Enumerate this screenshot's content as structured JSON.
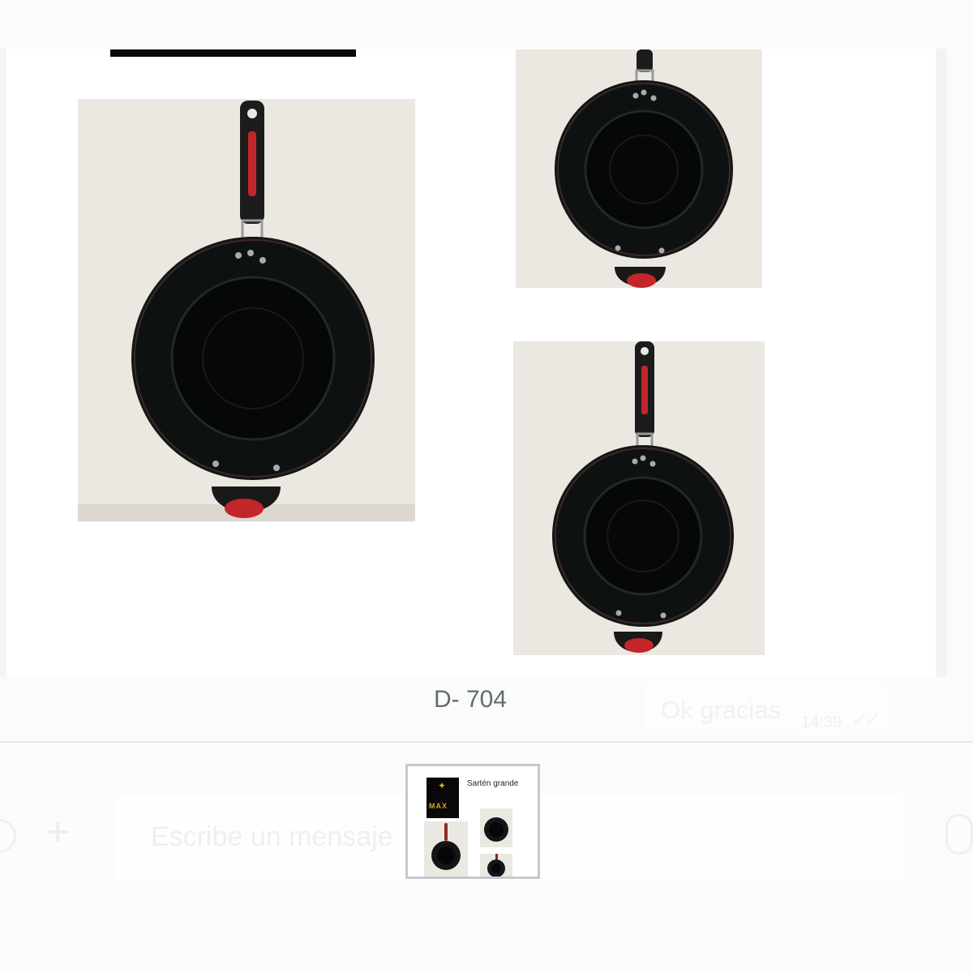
{
  "viewer": {
    "caption": "D- 704"
  },
  "chat_background": {
    "message_text": "Ok gracias",
    "message_time": "14:39",
    "message_ticks": "✓✓",
    "composer_placeholder": "Escribe un mensaje",
    "plus_glyph": "+"
  },
  "thumbnail": {
    "logo_text": "MAX",
    "logo_star": "✦",
    "title": "Sartén grande"
  },
  "icons": [
    "emoji-icon",
    "plus-icon",
    "microphone-icon",
    "double-check-icon"
  ]
}
